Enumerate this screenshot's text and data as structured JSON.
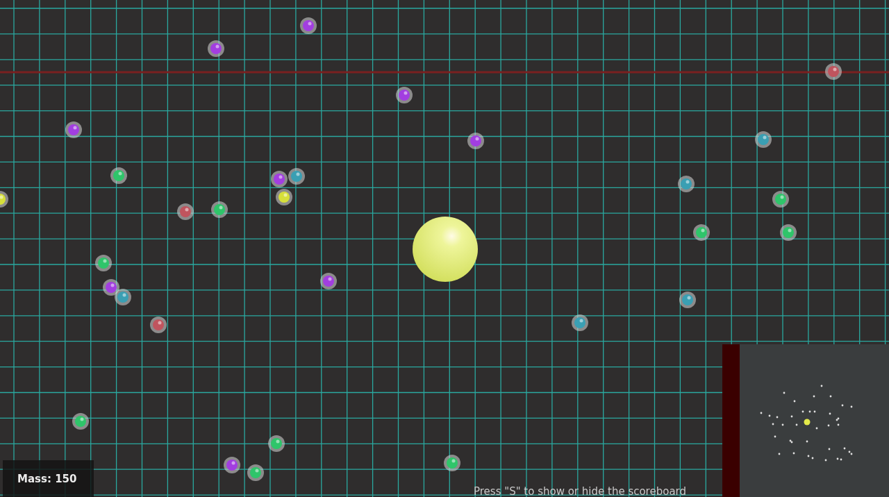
{
  "hud": {
    "mass": "Mass: 150"
  },
  "hint": "Press \"S\" to show or hide the scoreboard"
}
